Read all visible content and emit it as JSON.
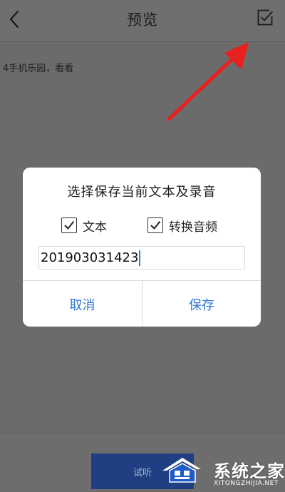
{
  "header": {
    "title": "预览",
    "back_icon": "chevron-left-icon",
    "confirm_icon": "checkbox-check-icon"
  },
  "content": {
    "text": "4手机乐园，看看"
  },
  "annotation": {
    "color": "#e8201e"
  },
  "dialog": {
    "title": "选择保存当前文本及录音",
    "options": [
      {
        "label": "文本",
        "checked": true
      },
      {
        "label": "转换音频",
        "checked": true
      }
    ],
    "filename_value": "201903031423",
    "cancel_label": "取消",
    "save_label": "保存",
    "accent_color": "#2f76d6"
  },
  "footer": {
    "listen_label": "试听"
  },
  "watermark": {
    "brand": "系统之家",
    "site": "XITONGZHIJIA.NET"
  }
}
